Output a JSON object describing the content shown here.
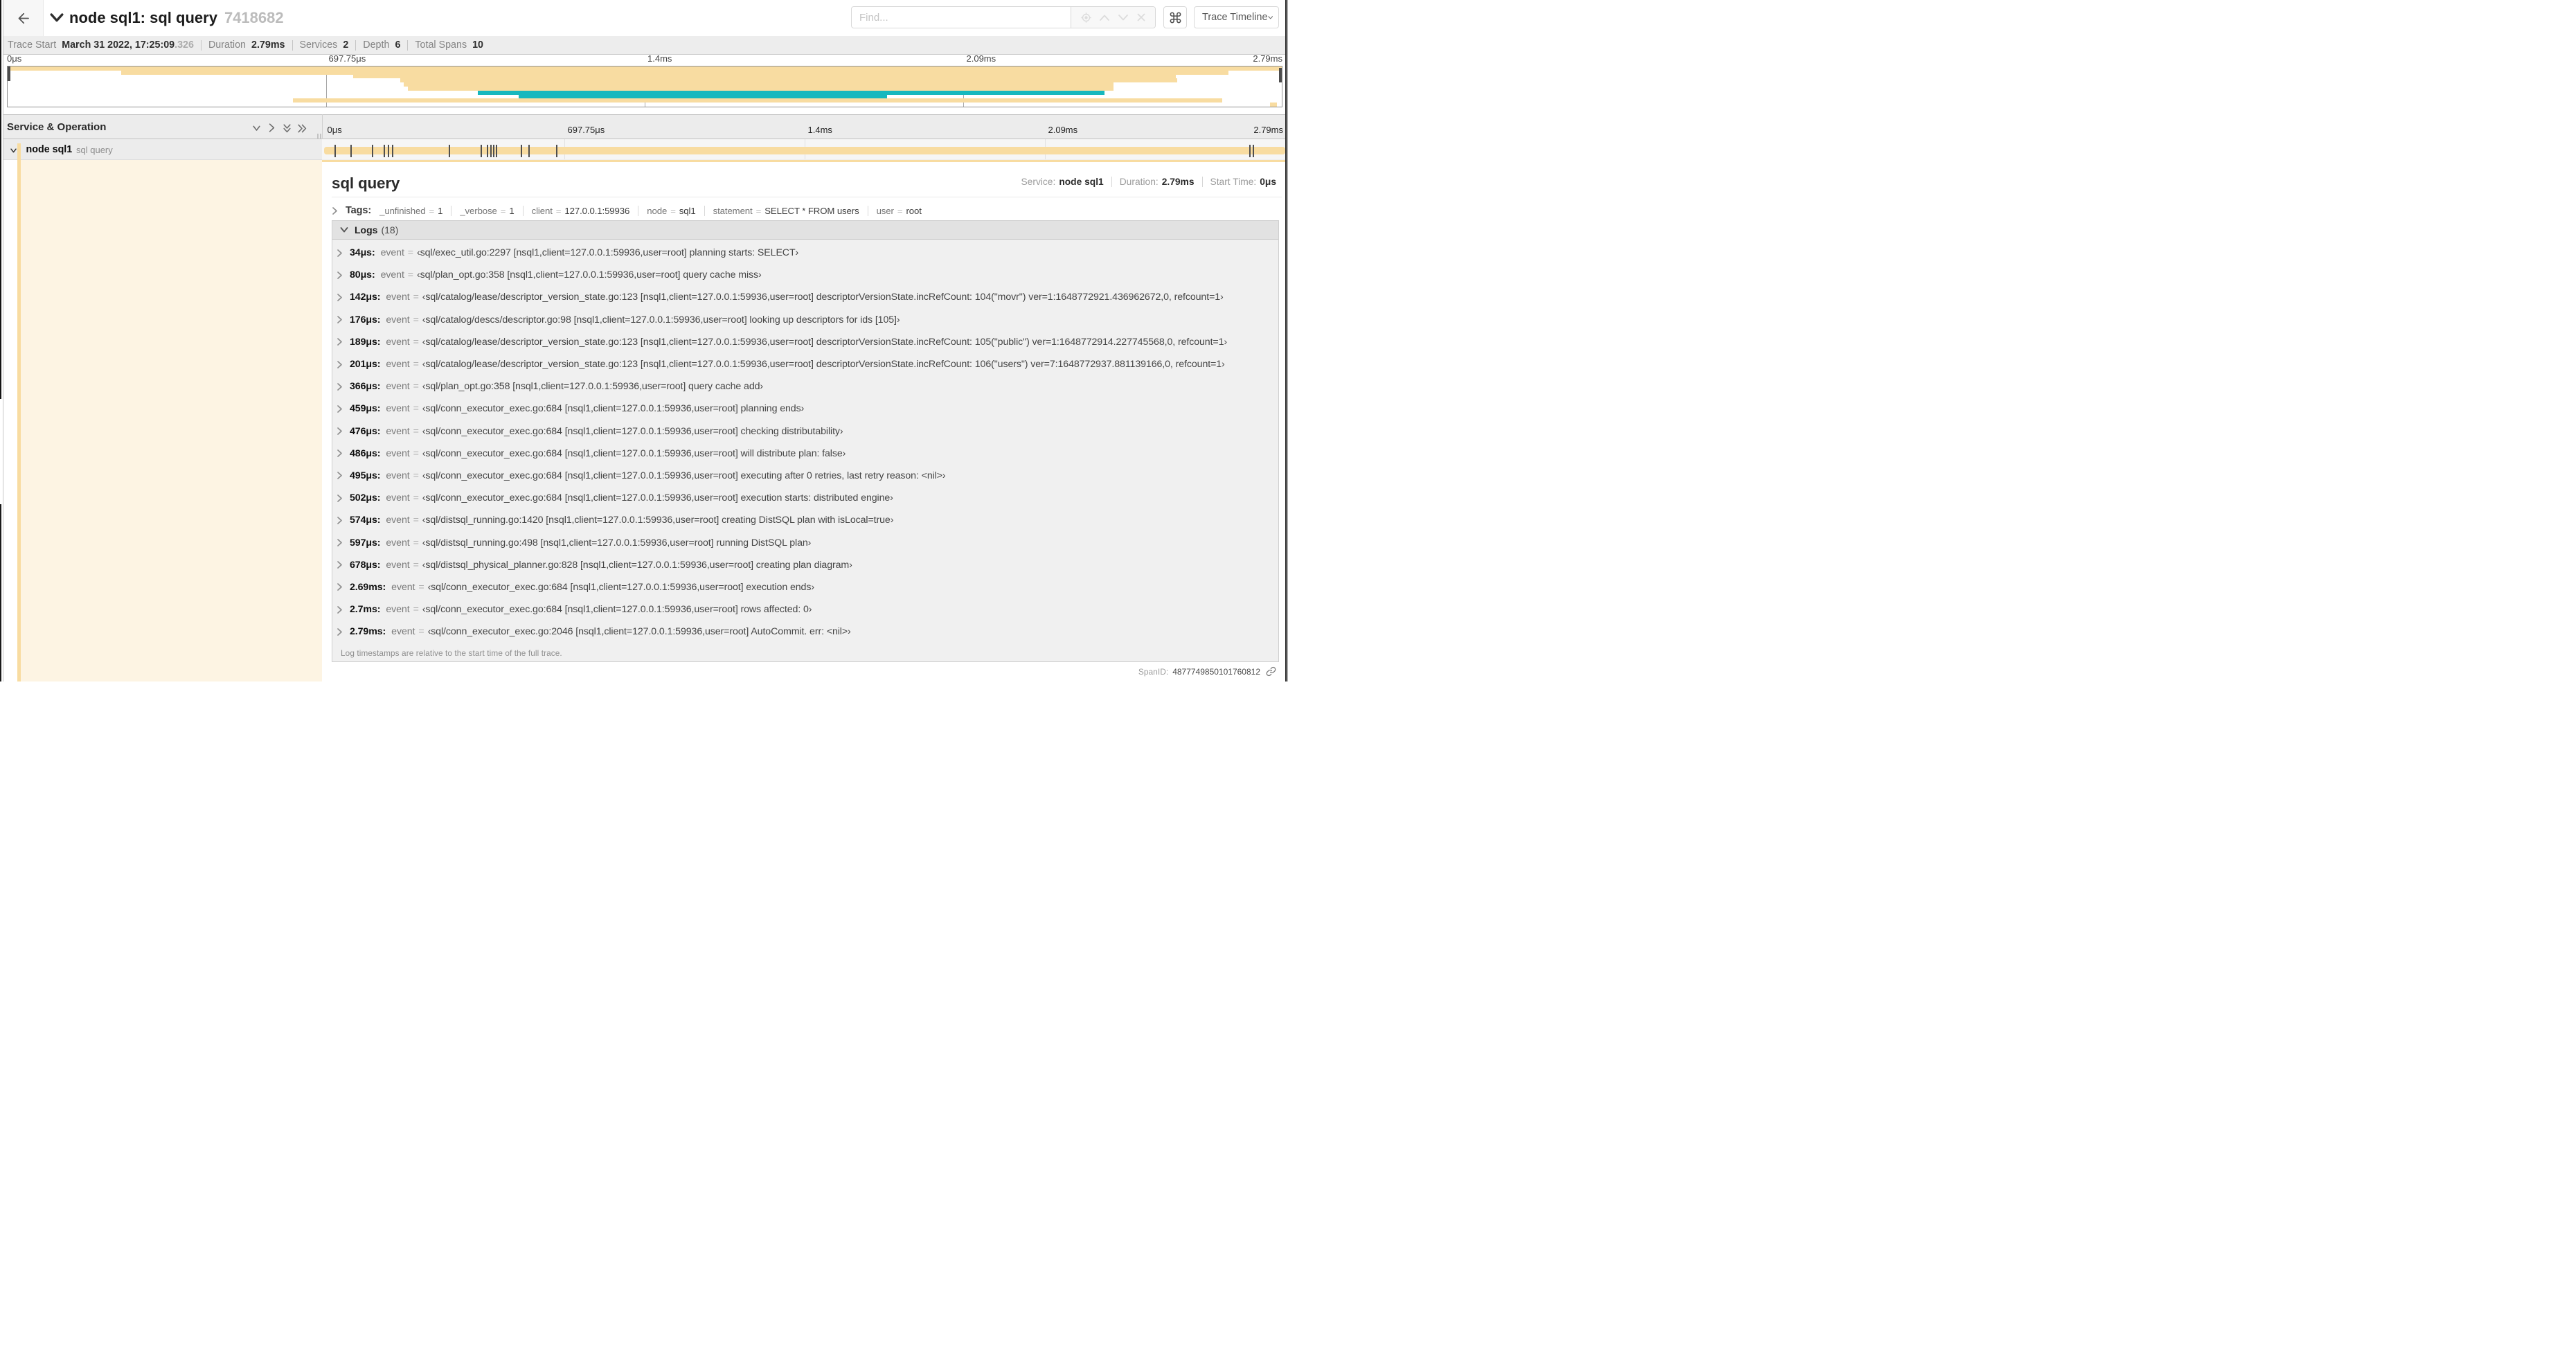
{
  "header": {
    "title": "node sql1: sql query",
    "trace_id_short": "7418682",
    "find_placeholder": "Find...",
    "view_selector": "Trace Timeline",
    "back_icon": "left-arrow",
    "shortcut_icon": "command-key"
  },
  "trace_summary": {
    "items": [
      {
        "label": "Trace Start",
        "value": "March 31 2022, 17:25:09",
        "value_muted": ".326"
      },
      {
        "label": "Duration",
        "value": "2.79ms"
      },
      {
        "label": "Services",
        "value": "2"
      },
      {
        "label": "Depth",
        "value": "6"
      },
      {
        "label": "Total Spans",
        "value": "10"
      }
    ]
  },
  "colors": {
    "service_node_sql1": "#F8DCA1",
    "service_other": "#17B8BE",
    "detail_background": "#FDF4E3"
  },
  "minimap": {
    "axis_labels": [
      "0μs",
      "697.75μs",
      "1.4ms",
      "2.09ms",
      "2.79ms"
    ],
    "spans": [
      {
        "start": 0.0,
        "end": 1.0,
        "color": "#F8DCA1"
      },
      {
        "start": 0.089,
        "end": 0.958,
        "color": "#F8DCA1"
      },
      {
        "start": 0.271,
        "end": 0.917,
        "color": "#F8DCA1"
      },
      {
        "start": 0.308,
        "end": 0.918,
        "color": "#F8DCA1"
      },
      {
        "start": 0.311,
        "end": 0.868,
        "color": "#F8DCA1"
      },
      {
        "start": 0.314,
        "end": 0.868,
        "color": "#F8DCA1"
      },
      {
        "start": 0.369,
        "end": 0.861,
        "color": "#17B8BE"
      },
      {
        "start": 0.401,
        "end": 0.69,
        "color": "#17B8BE"
      },
      {
        "start": 0.224,
        "end": 0.953,
        "color": "#F8DCA1"
      },
      {
        "start": 0.991,
        "end": 0.996,
        "color": "#F8DCA1"
      }
    ]
  },
  "timeline": {
    "column_header": "Service & Operation",
    "axis_labels": [
      "0μs",
      "697.75μs",
      "1.4ms",
      "2.09ms",
      "2.79ms"
    ]
  },
  "span_row": {
    "service": "node sql1",
    "operation": "sql query",
    "duration_us": 2790,
    "log_ticks_us": [
      34,
      80,
      142,
      176,
      189,
      201,
      366,
      459,
      476,
      486,
      495,
      502,
      574,
      597,
      678,
      2690,
      2700,
      2790
    ]
  },
  "detail": {
    "title": "sql query",
    "meta": [
      {
        "label": "Service:",
        "value": "node sql1"
      },
      {
        "label": "Duration:",
        "value": "2.79ms"
      },
      {
        "label": "Start Time:",
        "value": "0μs"
      }
    ],
    "tags_label": "Tags:",
    "tags": [
      {
        "key": "_unfinished",
        "value": "1"
      },
      {
        "key": "_verbose",
        "value": "1"
      },
      {
        "key": "client",
        "value": "127.0.0.1:59936"
      },
      {
        "key": "node",
        "value": "sql1"
      },
      {
        "key": "statement",
        "value": "SELECT * FROM users"
      },
      {
        "key": "user",
        "value": "root"
      }
    ],
    "logs": {
      "label": "Logs",
      "count": 18,
      "rows": [
        {
          "ts": "34μs:",
          "key": "event",
          "value": "sql/exec_util.go:2297 [nsql1,client=127.0.0.1:59936,user=root] planning starts: SELECT"
        },
        {
          "ts": "80μs:",
          "key": "event",
          "value": "sql/plan_opt.go:358 [nsql1,client=127.0.0.1:59936,user=root] query cache miss"
        },
        {
          "ts": "142μs:",
          "key": "event",
          "value": "sql/catalog/lease/descriptor_version_state.go:123 [nsql1,client=127.0.0.1:59936,user=root] descriptorVersionState.incRefCount: 104(\"movr\") ver=1:1648772921.436962672,0, refcount=1"
        },
        {
          "ts": "176μs:",
          "key": "event",
          "value": "sql/catalog/descs/descriptor.go:98 [nsql1,client=127.0.0.1:59936,user=root] looking up descriptors for ids [105]"
        },
        {
          "ts": "189μs:",
          "key": "event",
          "value": "sql/catalog/lease/descriptor_version_state.go:123 [nsql1,client=127.0.0.1:59936,user=root] descriptorVersionState.incRefCount: 105(\"public\") ver=1:1648772914.227745568,0, refcount=1"
        },
        {
          "ts": "201μs:",
          "key": "event",
          "value": "sql/catalog/lease/descriptor_version_state.go:123 [nsql1,client=127.0.0.1:59936,user=root] descriptorVersionState.incRefCount: 106(\"users\") ver=7:1648772937.881139166,0, refcount=1"
        },
        {
          "ts": "366μs:",
          "key": "event",
          "value": "sql/plan_opt.go:358 [nsql1,client=127.0.0.1:59936,user=root] query cache add"
        },
        {
          "ts": "459μs:",
          "key": "event",
          "value": "sql/conn_executor_exec.go:684 [nsql1,client=127.0.0.1:59936,user=root] planning ends"
        },
        {
          "ts": "476μs:",
          "key": "event",
          "value": "sql/conn_executor_exec.go:684 [nsql1,client=127.0.0.1:59936,user=root] checking distributability"
        },
        {
          "ts": "486μs:",
          "key": "event",
          "value": "sql/conn_executor_exec.go:684 [nsql1,client=127.0.0.1:59936,user=root] will distribute plan: false"
        },
        {
          "ts": "495μs:",
          "key": "event",
          "value": "sql/conn_executor_exec.go:684 [nsql1,client=127.0.0.1:59936,user=root] executing after 0 retries, last retry reason: <nil>"
        },
        {
          "ts": "502μs:",
          "key": "event",
          "value": "sql/conn_executor_exec.go:684 [nsql1,client=127.0.0.1:59936,user=root] execution starts: distributed engine"
        },
        {
          "ts": "574μs:",
          "key": "event",
          "value": "sql/distsql_running.go:1420 [nsql1,client=127.0.0.1:59936,user=root] creating DistSQL plan with isLocal=true"
        },
        {
          "ts": "597μs:",
          "key": "event",
          "value": "sql/distsql_running.go:498 [nsql1,client=127.0.0.1:59936,user=root] running DistSQL plan"
        },
        {
          "ts": "678μs:",
          "key": "event",
          "value": "sql/distsql_physical_planner.go:828 [nsql1,client=127.0.0.1:59936,user=root] creating plan diagram"
        },
        {
          "ts": "2.69ms:",
          "key": "event",
          "value": "sql/conn_executor_exec.go:684 [nsql1,client=127.0.0.1:59936,user=root] execution ends"
        },
        {
          "ts": "2.7ms:",
          "key": "event",
          "value": "sql/conn_executor_exec.go:684 [nsql1,client=127.0.0.1:59936,user=root] rows affected: 0"
        },
        {
          "ts": "2.79ms:",
          "key": "event",
          "value": "sql/conn_executor_exec.go:2046 [nsql1,client=127.0.0.1:59936,user=root] AutoCommit. err: <nil>"
        }
      ],
      "note": "Log timestamps are relative to the start time of the full trace."
    },
    "span_id_label": "SpanID:",
    "span_id": "4877749850101760812"
  }
}
